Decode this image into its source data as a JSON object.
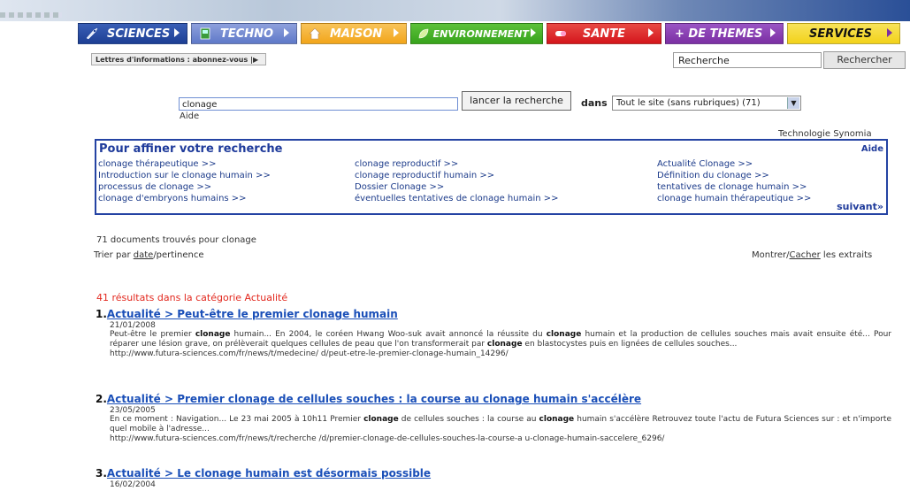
{
  "nav": {
    "tabs": [
      {
        "label": "SCIENCES",
        "color": "#1d3f94",
        "icon": "rocket-icon"
      },
      {
        "label": "TECHNO",
        "color": "#5f79c8",
        "icon": "computer-icon"
      },
      {
        "label": "MAISON",
        "color": "#f2a51a",
        "icon": "house-icon"
      },
      {
        "label": "ENVIRONNEMENT",
        "color": "#37a31c",
        "icon": "leaf-icon"
      },
      {
        "label": "SANTE",
        "color": "#d4151c",
        "icon": "pill-icon"
      },
      {
        "label": "+ DE THEMES",
        "color": "#7b2fa3",
        "icon": ""
      },
      {
        "label": "SERVICES",
        "color": "#f2d21a",
        "icon": ""
      }
    ]
  },
  "header": {
    "newsletter_label": "Lettres d'informations : abonnez-vous |▶",
    "search_value": "Recherche",
    "search_button": "Rechercher"
  },
  "query": {
    "value": "clonage",
    "submit_label": "lancer la recherche",
    "help": "Aide",
    "dans_label": "dans",
    "scope_selected": "Tout le site (sans rubriques) (71)"
  },
  "provider": "Technologie Synomia",
  "refine": {
    "title": "Pour affiner votre recherche",
    "help": "Aide",
    "more": "suivant»",
    "col1": [
      "clonage thérapeutique >>",
      "Introduction sur le clonage humain >>",
      "processus de clonage >>",
      "clonage d'embryons humains >>"
    ],
    "col2": [
      "clonage reproductif >>",
      "clonage reproductif humain >>",
      "Dossier Clonage >>",
      "éventuelles tentatives de clonage humain >>"
    ],
    "col3": [
      "Actualité Clonage >>",
      "Définition du clonage >>",
      "tentatives de clonage humain >>",
      "clonage humain thérapeutique >>"
    ]
  },
  "results_meta": {
    "count_text": "71 documents trouvés pour clonage",
    "sort_prefix": "Trier par",
    "sort_date": "date",
    "sort_sep": "/pertinence",
    "show": "Montrer/",
    "hide": "Cacher",
    "extracts": " les extraits"
  },
  "category_heading": "41 résultats dans la catégorie Actualité",
  "results": [
    {
      "num": "1.",
      "title": "Actualité > Peut-être le premier clonage humain",
      "date": "21/01/2008",
      "snippet_parts": [
        "Peut-être le premier ",
        "clonage",
        " humain... En 2004, le coréen Hwang Woo-suk avait annoncé la réussite du ",
        "clonage",
        " humain et la production de cellules souches mais avait ensuite été... Pour réparer une lésion grave, on prélèverait quelques cellules de peau que l'on transformerait par ",
        "clonage",
        " en blastocystes puis en lignées de cellules souches..."
      ],
      "url": "http://www.futura-sciences.com/fr/news/t/medecine/ d/peut-etre-le-premier-clonage-humain_14296/"
    },
    {
      "num": "2.",
      "title": "Actualité > Premier clonage de cellules souches : la course au clonage humain s'accélère",
      "date": "23/05/2005",
      "snippet_parts": [
        "En ce moment : Navigation... Le 23 mai 2005 à 10h11 Premier ",
        "clonage",
        " de cellules souches : la course au ",
        "clonage",
        " humain s'accélère Retrouvez toute l'actu de Futura Sciences sur : et n'importe quel mobile à l'adresse..."
      ],
      "url": "http://www.futura-sciences.com/fr/news/t/recherche /d/premier-clonage-de-cellules-souches-la-course-a u-clonage-humain-saccelere_6296/"
    },
    {
      "num": "3.",
      "title": "Actualité > Le clonage humain est désormais possible",
      "date": "16/02/2004",
      "snippet_parts": [],
      "url": ""
    }
  ]
}
